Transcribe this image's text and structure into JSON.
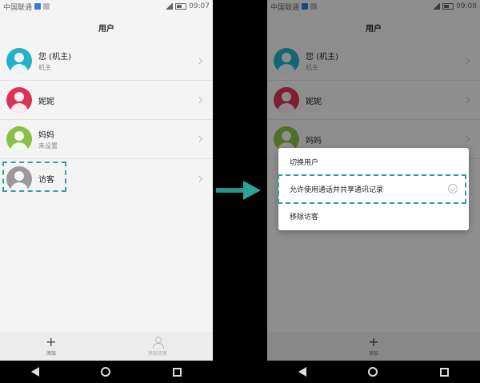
{
  "left_screen": {
    "status": {
      "carrier": "中国联通",
      "time": "09:07"
    },
    "title": "用户",
    "users": [
      {
        "name": "您 (机主)",
        "sub": "机主",
        "avatar_color": "#25b0c8"
      },
      {
        "name": "妮妮",
        "sub": "",
        "avatar_color": "#d8345a"
      },
      {
        "name": "妈妈",
        "sub": "未设置",
        "avatar_color": "#8ac046"
      },
      {
        "name": "访客",
        "sub": "",
        "avatar_color": "#9a9a9a"
      }
    ],
    "bottom": {
      "add_label": "添加",
      "guest_label": "添加访客"
    }
  },
  "right_screen": {
    "status": {
      "carrier": "中国联通",
      "time": "09:08"
    },
    "title": "用户",
    "users": [
      {
        "name": "您 (机主)",
        "sub": "机主",
        "avatar_color": "#25b0c8"
      },
      {
        "name": "妮妮",
        "sub": "",
        "avatar_color": "#d8345a"
      },
      {
        "name": "妈妈",
        "sub": "",
        "avatar_color": "#8ac046"
      }
    ],
    "dialog": {
      "items": [
        "切换用户",
        "允许使用通话并共享通讯记录",
        "移除访客"
      ]
    },
    "bottom": {
      "add_label": "添加"
    }
  },
  "colors": {
    "highlight": "#2ea39b",
    "arrow": "#2ea39b"
  }
}
